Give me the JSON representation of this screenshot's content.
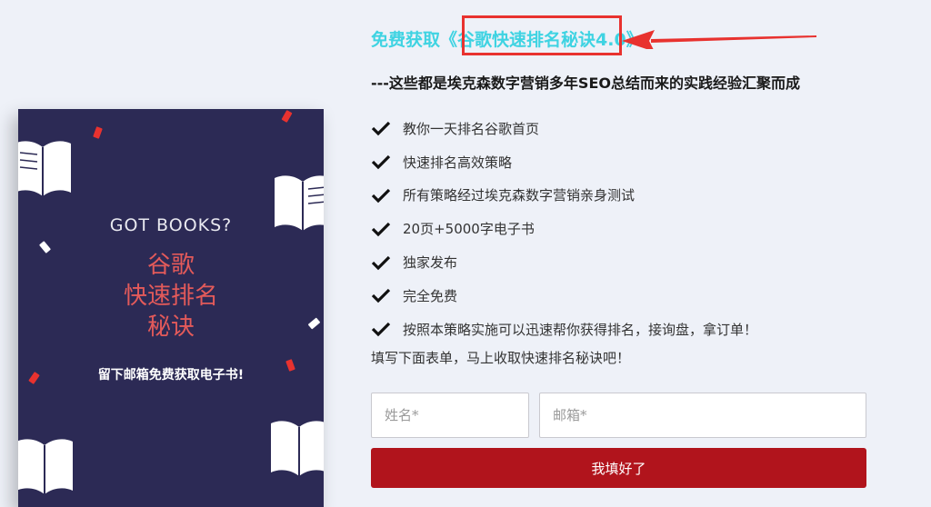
{
  "cover": {
    "title": "GOT BOOKS?",
    "subtitle_lines": [
      "谷歌",
      "快速排名",
      "秘诀"
    ],
    "footer": "留下邮箱免费获取电子书!"
  },
  "heading": {
    "prefix": "免费获取《",
    "highlight": "谷歌快速排名秘诀",
    "suffix": "4.0》"
  },
  "subheading": "---这些都是埃克森数字营销多年SEO总结而来的实践经验汇聚而成",
  "features": [
    "教你一天排名谷歌首页",
    "快速排名高效策略",
    "所有策略经过埃克森数字营销亲身测试",
    "20页+5000字电子书",
    "独家发布",
    "完全免费",
    "按照本策略实施可以迅速帮你获得排名，接询盘，拿订单！"
  ],
  "form": {
    "prompt": "填写下面表单，马上收取快速排名秘诀吧！",
    "name_placeholder": "姓名*",
    "email_placeholder": "邮箱*",
    "submit_label": "我填好了"
  },
  "colors": {
    "heading": "#3fd3e2",
    "highlight_border": "#e8322f",
    "submit_bg": "#b1141c",
    "cover_bg": "#2c2a55",
    "cover_accent": "#e35a5a"
  }
}
